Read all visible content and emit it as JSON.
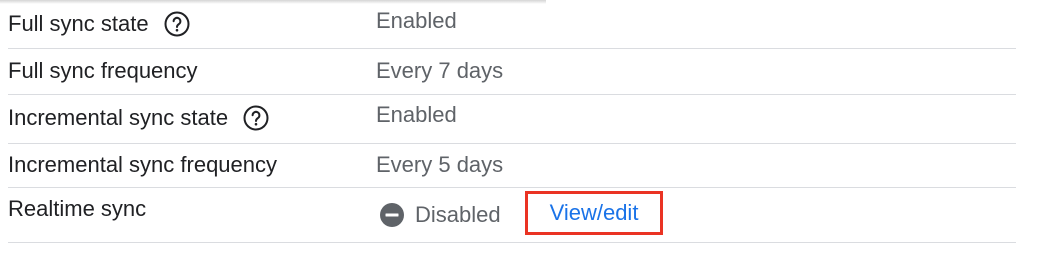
{
  "rows": [
    {
      "label": "Full sync state",
      "value": "Enabled",
      "has_help": true
    },
    {
      "label": "Full sync frequency",
      "value": "Every 7 days",
      "has_help": false
    },
    {
      "label": "Incremental sync state",
      "value": "Enabled",
      "has_help": true
    },
    {
      "label": "Incremental sync frequency",
      "value": "Every 5 days",
      "has_help": false
    },
    {
      "label": "Realtime sync",
      "value": "Disabled",
      "status_icon": "disabled-minus-circle-icon",
      "link": "View/edit"
    }
  ],
  "colors": {
    "label_text": "#202124",
    "value_text": "#5f6368",
    "link": "#1a73e8",
    "highlight_border": "#ea3323",
    "divider": "#dadce0"
  },
  "icons": {
    "help": "help-circle-icon",
    "disabled": "disabled-minus-circle-icon"
  }
}
